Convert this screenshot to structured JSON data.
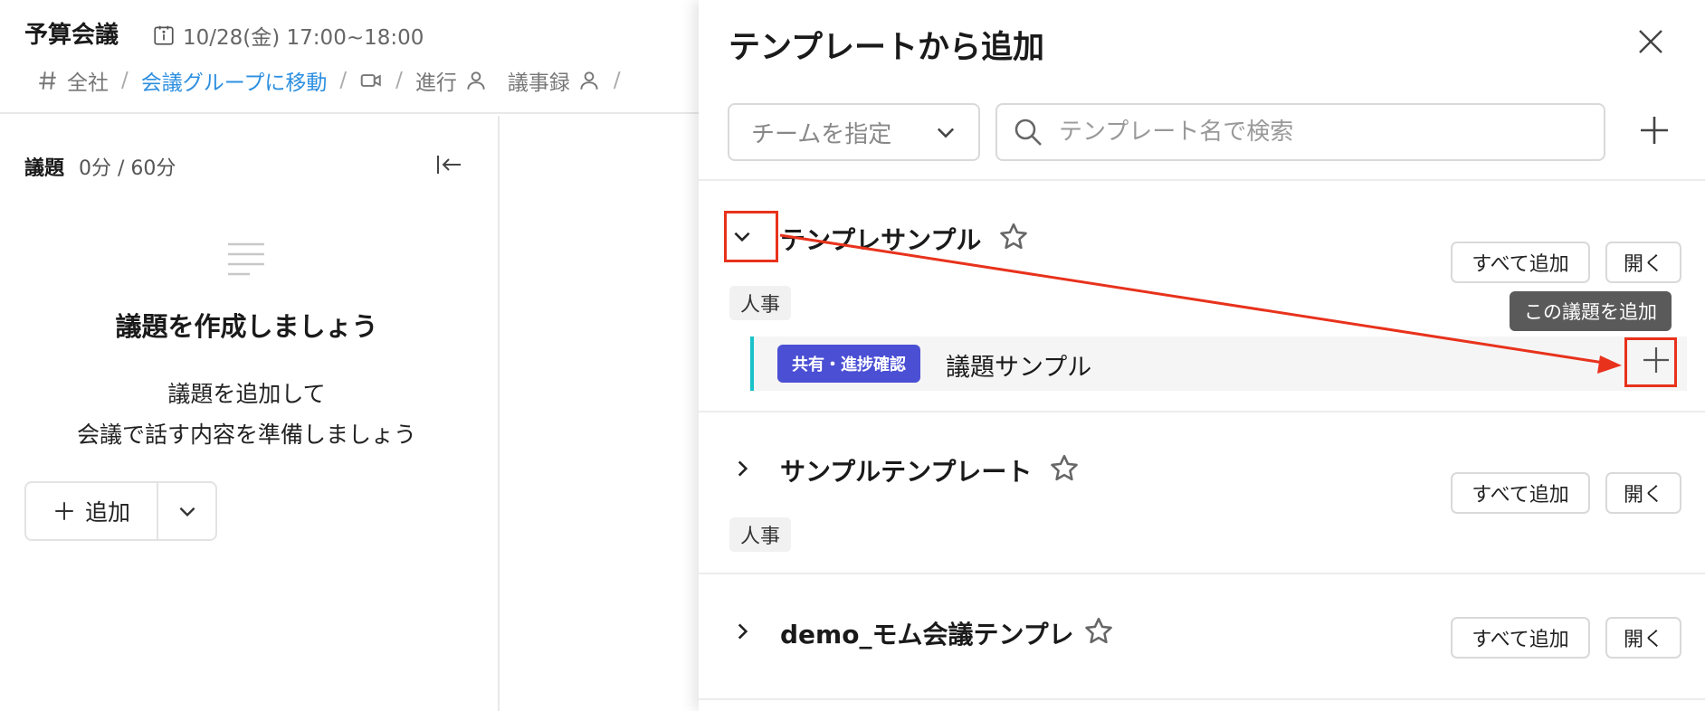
{
  "meeting": {
    "title": "予算会議",
    "datetime": "10/28(金) 17:00~18:00",
    "breadcrumbs": {
      "org": "全社",
      "group_link": "会議グループに移動",
      "facilitator": "進行",
      "minutes": "議事録"
    }
  },
  "agenda": {
    "title": "議題",
    "count": "0分 / 60分",
    "empty_title": "議題を作成しましょう",
    "empty_desc_line1": "議題を追加して",
    "empty_desc_line2": "会議で話す内容を準備しましょう",
    "add_label": "追加"
  },
  "panel": {
    "title": "テンプレートから追加",
    "team_select": "チームを指定",
    "search_placeholder": "テンプレート名で検索",
    "add_all_label": "すべて追加",
    "open_label": "開く",
    "tooltip": "この議題を追加",
    "templates": [
      {
        "name": "テンプレサンプル",
        "expanded": true,
        "tag": "人事",
        "topics": [
          {
            "badge": "共有・進捗確認",
            "title": "議題サンプル"
          }
        ]
      },
      {
        "name": "サンプルテンプレート",
        "expanded": false,
        "tag": "人事"
      },
      {
        "name": "demo_モム会議テンプレ",
        "expanded": false
      }
    ]
  },
  "colors": {
    "link": "#2d8fe0",
    "badge": "#4a4fd4",
    "topic_accent": "#19c2c9",
    "highlight": "#e8321c"
  }
}
